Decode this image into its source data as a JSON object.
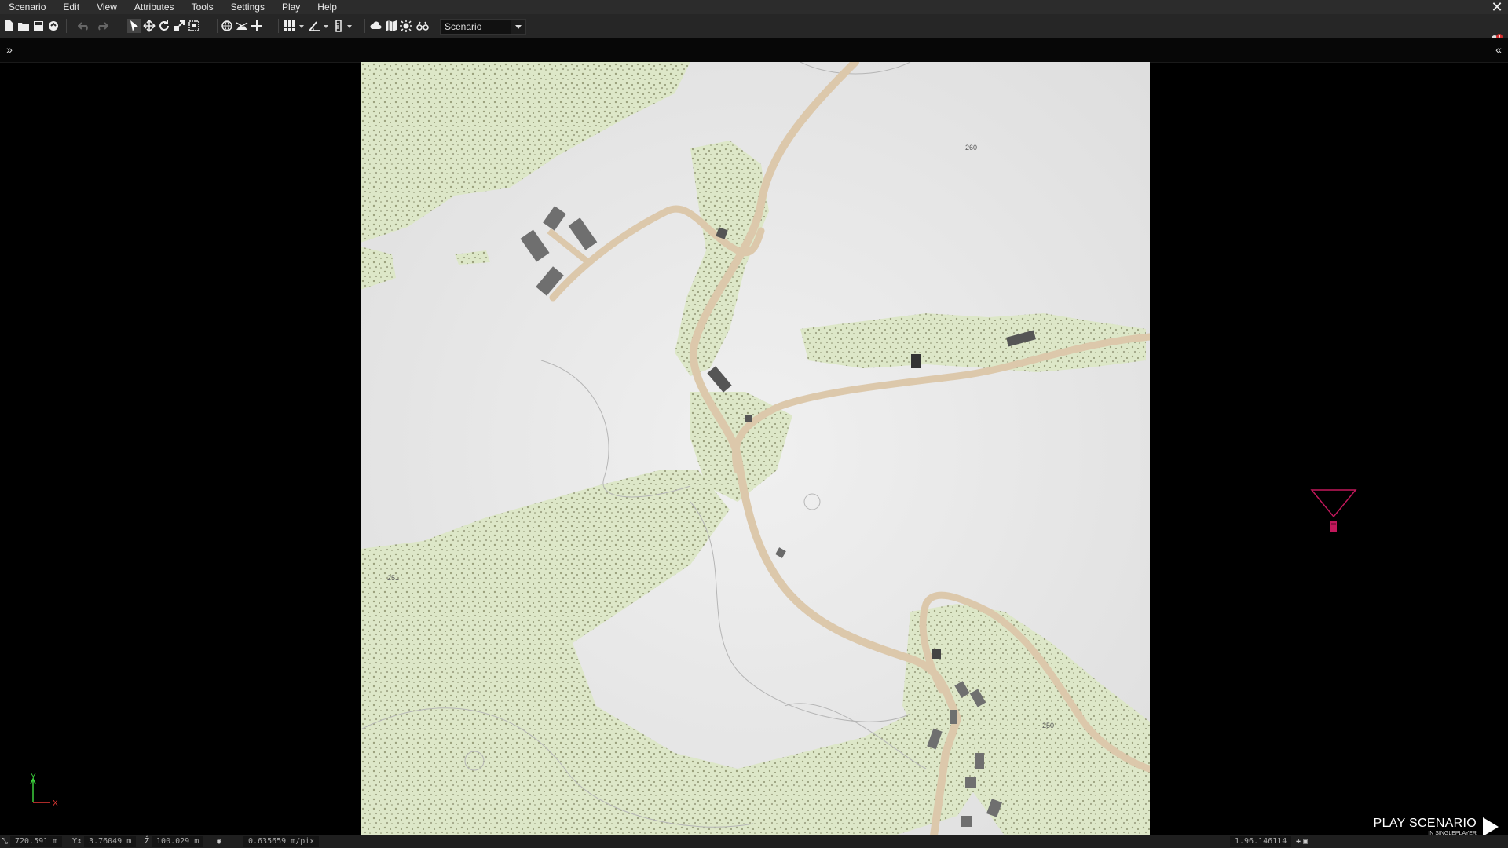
{
  "menu": [
    "Scenario",
    "Edit",
    "View",
    "Attributes",
    "Tools",
    "Settings",
    "Play",
    "Help"
  ],
  "toolbar": {
    "mode_select": "Scenario",
    "buttons": [
      "new-file-icon",
      "open-folder-icon",
      "save-icon",
      "save-as-icon",
      "publish-icon",
      "undo-icon",
      "redo-icon",
      "select-icon",
      "move-icon",
      "rotate-icon",
      "scale-icon",
      "area-select-icon",
      "globe-icon",
      "terrain-icon",
      "plus-icon",
      "grid-icon",
      "angle-icon",
      "vertical-icon",
      "weather-icon",
      "map-icon",
      "light-icon",
      "binoculars-icon"
    ]
  },
  "map": {
    "elevation_labels": [
      "260",
      "251",
      "250"
    ],
    "colors": {
      "terrain": "#e8e8e8",
      "forest": "#dfe9cc",
      "road": "#dcc8ab",
      "building": "#6f6f6f",
      "contour": "#b5b5b5",
      "camera": "#c2185b"
    }
  },
  "statusbar": {
    "x": "720.591 m",
    "y": "3.76049 m",
    "z": "100.029 m",
    "scale": "0.635659 m/pix",
    "zoom": "1.96.146114"
  },
  "play": {
    "title": "PLAY SCENARIO",
    "subtitle": "IN SINGLEPLAYER"
  },
  "axis": {
    "y": "Y",
    "x": "X"
  }
}
